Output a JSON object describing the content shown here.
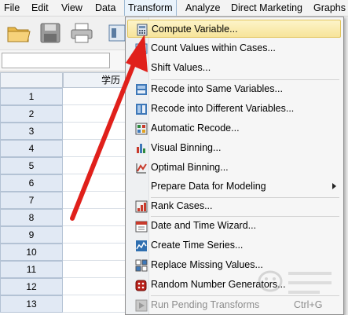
{
  "menubar": {
    "items": [
      "File",
      "Edit",
      "View",
      "Data",
      "Transform",
      "Analyze",
      "Direct Marketing",
      "Graphs"
    ],
    "active": "Transform"
  },
  "toolbar": {
    "icons": [
      "open-folder-icon",
      "save-icon",
      "print-icon",
      "dialog-recall-icon"
    ]
  },
  "grid": {
    "column_header": "学历",
    "rows": [
      "1",
      "2",
      "3",
      "4",
      "5",
      "6",
      "7",
      "8",
      "9",
      "10",
      "11",
      "12",
      "13"
    ]
  },
  "transform_menu": {
    "items": [
      {
        "label": "Compute Variable...",
        "icon": "calculator-icon",
        "highlighted": true
      },
      {
        "label": "Count Values within Cases...",
        "icon": "count-values-icon"
      },
      {
        "label": "Shift Values...",
        "icon": ""
      },
      {
        "label": "Recode into Same Variables...",
        "icon": "recode-same-icon"
      },
      {
        "label": "Recode into Different Variables...",
        "icon": "recode-different-icon"
      },
      {
        "label": "Automatic Recode...",
        "icon": "automatic-recode-icon"
      },
      {
        "label": "Visual Binning...",
        "icon": "visual-binning-icon"
      },
      {
        "label": "Optimal Binning...",
        "icon": "optimal-binning-icon"
      },
      {
        "label": "Prepare Data for Modeling",
        "icon": "",
        "submenu": true
      },
      {
        "label": "Rank Cases...",
        "icon": "rank-cases-icon"
      },
      {
        "label": "Date and Time Wizard...",
        "icon": "calendar-icon"
      },
      {
        "label": "Create Time Series...",
        "icon": "time-series-icon"
      },
      {
        "label": "Replace Missing Values...",
        "icon": "replace-missing-icon"
      },
      {
        "label": "Random Number Generators...",
        "icon": "dice-icon"
      },
      {
        "label": "Run Pending Transforms",
        "icon": "run-pending-icon",
        "disabled": true,
        "shortcut": "Ctrl+G"
      }
    ]
  },
  "colors": {
    "highlight": "#f7e49a",
    "annotation_arrow": "#e0201b"
  }
}
